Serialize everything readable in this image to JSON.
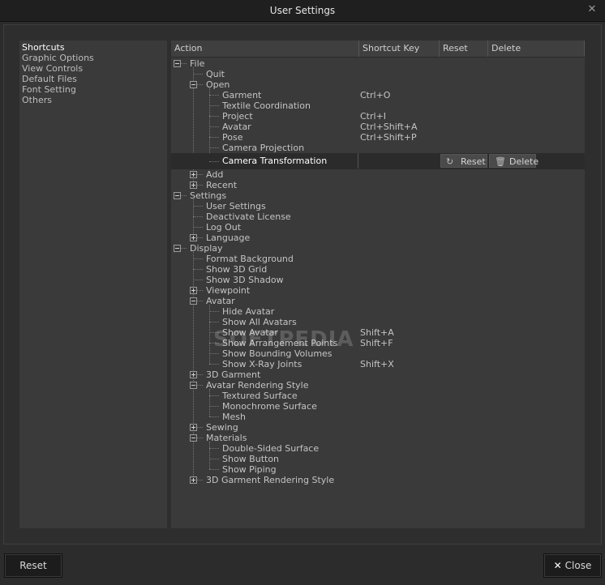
{
  "window": {
    "title": "User Settings",
    "close_glyph": "✕"
  },
  "sidebar": {
    "items": [
      {
        "label": "Shortcuts",
        "active": true
      },
      {
        "label": "Graphic Options"
      },
      {
        "label": "View Controls"
      },
      {
        "label": "Default Files"
      },
      {
        "label": "Font Setting"
      },
      {
        "label": "Others"
      }
    ]
  },
  "table": {
    "headers": {
      "action": "Action",
      "shortcut": "Shortcut Key",
      "reset": "Reset",
      "delete": "Delete"
    },
    "rows": [
      {
        "label": "File",
        "depth": 0,
        "exp": "minus"
      },
      {
        "label": "Quit",
        "depth": 1
      },
      {
        "label": "Open",
        "depth": 1,
        "exp": "minus"
      },
      {
        "label": "Garment",
        "depth": 2,
        "key": "Ctrl+O"
      },
      {
        "label": "Textile Coordination",
        "depth": 2
      },
      {
        "label": "Project",
        "depth": 2,
        "key": "Ctrl+I"
      },
      {
        "label": "Avatar",
        "depth": 2,
        "key": "Ctrl+Shift+A"
      },
      {
        "label": "Pose",
        "depth": 2,
        "key": "Ctrl+Shift+P"
      },
      {
        "label": "Camera Projection",
        "depth": 2
      },
      {
        "label": "Camera Transformation",
        "depth": 2,
        "selected": true
      },
      {
        "label": "Add",
        "depth": 1,
        "exp": "plus"
      },
      {
        "label": "Recent",
        "depth": 1,
        "exp": "plus"
      },
      {
        "label": "Settings",
        "depth": 0,
        "exp": "minus"
      },
      {
        "label": "User Settings",
        "depth": 1
      },
      {
        "label": "Deactivate License",
        "depth": 1
      },
      {
        "label": "Log Out",
        "depth": 1
      },
      {
        "label": "Language",
        "depth": 1,
        "exp": "plus"
      },
      {
        "label": "Display",
        "depth": 0,
        "exp": "minus"
      },
      {
        "label": "Format Background",
        "depth": 1
      },
      {
        "label": "Show 3D Grid",
        "depth": 1
      },
      {
        "label": "Show 3D Shadow",
        "depth": 1
      },
      {
        "label": "Viewpoint",
        "depth": 1,
        "exp": "plus"
      },
      {
        "label": "Avatar",
        "depth": 1,
        "exp": "minus"
      },
      {
        "label": "Hide Avatar",
        "depth": 2
      },
      {
        "label": "Show All Avatars",
        "depth": 2
      },
      {
        "label": "Show Avatar",
        "depth": 2,
        "key": "Shift+A"
      },
      {
        "label": "Show Arrangement Points",
        "depth": 2,
        "key": "Shift+F"
      },
      {
        "label": "Show Bounding Volumes",
        "depth": 2
      },
      {
        "label": "Show X-Ray Joints",
        "depth": 2,
        "key": "Shift+X"
      },
      {
        "label": "3D Garment",
        "depth": 1,
        "exp": "plus"
      },
      {
        "label": "Avatar Rendering Style",
        "depth": 1,
        "exp": "minus"
      },
      {
        "label": "Textured Surface",
        "depth": 2
      },
      {
        "label": "Monochrome Surface",
        "depth": 2
      },
      {
        "label": "Mesh",
        "depth": 2
      },
      {
        "label": "Sewing",
        "depth": 1,
        "exp": "plus"
      },
      {
        "label": "Materials",
        "depth": 1,
        "exp": "minus"
      },
      {
        "label": "Double-Sided Surface",
        "depth": 2
      },
      {
        "label": "Show Button",
        "depth": 2
      },
      {
        "label": "Show Piping",
        "depth": 2
      },
      {
        "label": "3D Garment Rendering Style",
        "depth": 1,
        "exp": "plus"
      }
    ],
    "row_reset_label": "Reset",
    "row_delete_label": "Delete",
    "row_reset_icon": "↻",
    "row_delete_icon": "🗑"
  },
  "watermark": "SOFTPEDIA",
  "footer": {
    "reset_label": "Reset",
    "close_label": "Close",
    "close_icon": "✕"
  },
  "colors": {
    "background": "#2c2c2c",
    "panel": "#3a3a3a",
    "selected_row": "#2b2b2b",
    "text": "#c4c4c4"
  }
}
